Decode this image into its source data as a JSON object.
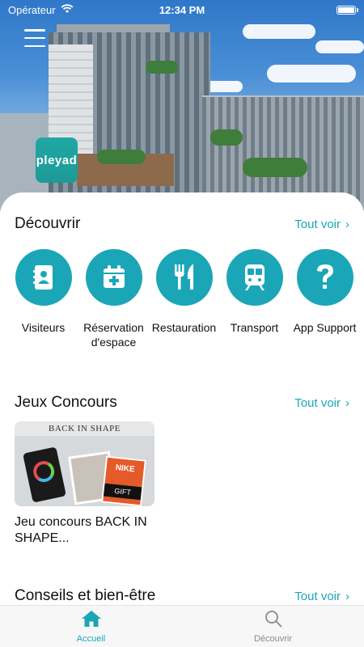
{
  "status_bar": {
    "carrier": "Opérateur",
    "time": "12:34 PM"
  },
  "hero": {
    "logo_text": "pleyad"
  },
  "colors": {
    "accent": "#1ba6b8",
    "logo": "#21a7a4"
  },
  "discover": {
    "title": "Découvrir",
    "see_all": "Tout voir",
    "services": [
      {
        "label": "Visiteurs",
        "icon": "contact-book-icon"
      },
      {
        "label": "Réservation d'espace",
        "icon": "calendar-plus-icon"
      },
      {
        "label": "Restauration",
        "icon": "fork-knife-icon"
      },
      {
        "label": "Transport",
        "icon": "train-icon"
      },
      {
        "label": "App Support",
        "icon": "question-mark-icon"
      }
    ]
  },
  "contests": {
    "title": "Jeux Concours",
    "see_all": "Tout voir",
    "card": {
      "image_banner": "BACK IN SHAPE",
      "image_brand": "NIKE",
      "image_gift": "GIFT",
      "title": "Jeu concours BACK IN SHAPE..."
    }
  },
  "wellbeing": {
    "title": "Conseils et bien-être",
    "see_all": "Tout voir"
  },
  "tabbar": {
    "items": [
      {
        "label": "Accueil",
        "icon": "home-icon",
        "active": true
      },
      {
        "label": "Découvrir",
        "icon": "search-icon",
        "active": false
      }
    ]
  }
}
